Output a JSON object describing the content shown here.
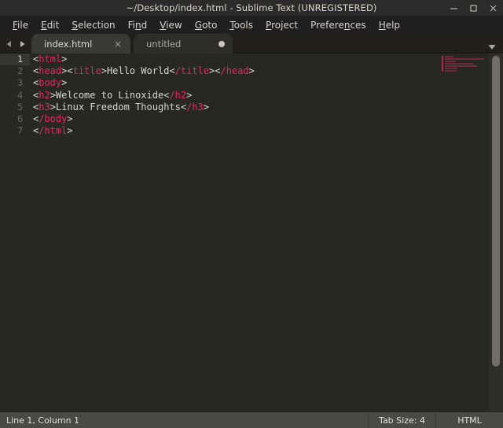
{
  "window": {
    "title": "~/Desktop/index.html - Sublime Text (UNREGISTERED)",
    "controls": {
      "minimize": "minimize-icon",
      "maximize": "maximize-icon",
      "close": "close-icon"
    }
  },
  "menubar": {
    "items": [
      {
        "label": "File",
        "mnemonic_index": 0
      },
      {
        "label": "Edit",
        "mnemonic_index": 0
      },
      {
        "label": "Selection",
        "mnemonic_index": 0
      },
      {
        "label": "Find",
        "mnemonic_index": 2
      },
      {
        "label": "View",
        "mnemonic_index": 0
      },
      {
        "label": "Goto",
        "mnemonic_index": 0
      },
      {
        "label": "Tools",
        "mnemonic_index": 0
      },
      {
        "label": "Project",
        "mnemonic_index": 0
      },
      {
        "label": "Preferences",
        "mnemonic_index": 7
      },
      {
        "label": "Help",
        "mnemonic_index": 0
      }
    ]
  },
  "tabbar": {
    "prev_arrow": "triangle-left-icon",
    "next_arrow": "triangle-right-icon",
    "overflow_menu": "chevron-down-icon",
    "tabs": [
      {
        "label": "index.html",
        "active": true,
        "dirty": false,
        "close_glyph": "×"
      },
      {
        "label": "untitled",
        "active": false,
        "dirty": true,
        "close_glyph": "×"
      }
    ]
  },
  "editor": {
    "current_line": 1,
    "gutter": [
      "1",
      "2",
      "3",
      "4",
      "5",
      "6",
      "7"
    ],
    "lines": [
      [
        {
          "t": "punc",
          "v": "<"
        },
        {
          "t": "tag",
          "v": "html"
        },
        {
          "t": "punc",
          "v": ">"
        }
      ],
      [
        {
          "t": "punc",
          "v": "<"
        },
        {
          "t": "tag",
          "v": "head"
        },
        {
          "t": "punc",
          "v": "><"
        },
        {
          "t": "tag",
          "v": "title"
        },
        {
          "t": "punc",
          "v": ">"
        },
        {
          "t": "text",
          "v": "Hello World"
        },
        {
          "t": "punc",
          "v": "<"
        },
        {
          "t": "tag",
          "v": "/title"
        },
        {
          "t": "punc",
          "v": "><"
        },
        {
          "t": "tag",
          "v": "/head"
        },
        {
          "t": "punc",
          "v": ">"
        }
      ],
      [
        {
          "t": "punc",
          "v": "<"
        },
        {
          "t": "tag",
          "v": "body"
        },
        {
          "t": "punc",
          "v": ">"
        }
      ],
      [
        {
          "t": "punc",
          "v": "<"
        },
        {
          "t": "tag",
          "v": "h2"
        },
        {
          "t": "punc",
          "v": ">"
        },
        {
          "t": "text",
          "v": "Welcome to Linoxide"
        },
        {
          "t": "punc",
          "v": "<"
        },
        {
          "t": "tag",
          "v": "/h2"
        },
        {
          "t": "punc",
          "v": ">"
        }
      ],
      [
        {
          "t": "punc",
          "v": "<"
        },
        {
          "t": "tag",
          "v": "h3"
        },
        {
          "t": "punc",
          "v": ">"
        },
        {
          "t": "text",
          "v": "Linux Freedom Thoughts"
        },
        {
          "t": "punc",
          "v": "<"
        },
        {
          "t": "tag",
          "v": "/h3"
        },
        {
          "t": "punc",
          "v": ">"
        }
      ],
      [
        {
          "t": "punc",
          "v": "<"
        },
        {
          "t": "tag",
          "v": "/body"
        },
        {
          "t": "punc",
          "v": ">"
        }
      ],
      [
        {
          "t": "punc",
          "v": "<"
        },
        {
          "t": "tag",
          "v": "/html"
        },
        {
          "t": "punc",
          "v": ">"
        }
      ]
    ],
    "raw_text": [
      "<html>",
      "<head><title>Hello World</title></head>",
      "<body>",
      "<h2>Welcome to Linoxide</h2>",
      "<h3>Linux Freedom Thoughts</h3>",
      "</body>",
      "</html>"
    ]
  },
  "minimap": {
    "line_widths_pct": [
      22,
      96,
      26,
      70,
      78,
      30,
      28
    ]
  },
  "statusbar": {
    "position": "Line 1, Column 1",
    "tab_size": "Tab Size: 4",
    "syntax": "HTML"
  },
  "colors": {
    "editor_bg": "#272822",
    "tag": "#e0285e",
    "punctuation": "#d8d8ce",
    "plain_text": "#d6d6cc",
    "gutter_text": "#6a6a60",
    "current_line_bg": "#363730",
    "titlebar_bg": "#2b2b2b",
    "menubar_bg": "#1f1f1f",
    "tabbar_bg": "#201f1a",
    "active_tab_bg": "#3a3a35",
    "inactive_tab_bg": "#2e2e29",
    "statusbar_bg": "#4a4a45"
  }
}
